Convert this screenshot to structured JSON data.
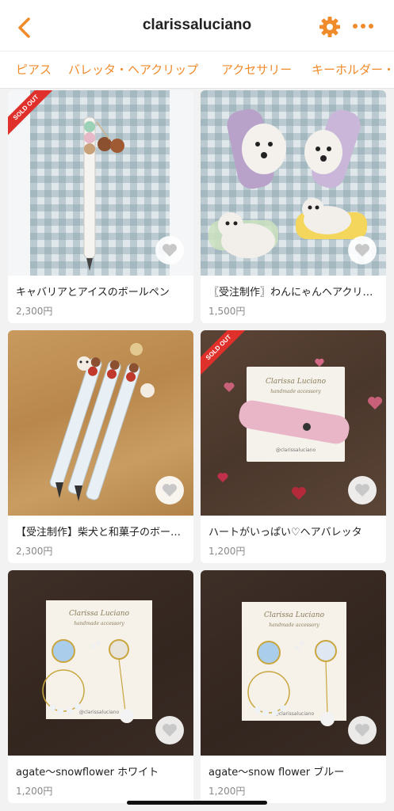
{
  "header": {
    "title": "clarissaluciano"
  },
  "tabs": [
    "ピアス",
    "バレッタ・ヘアクリップ",
    "アクセサリー",
    "キーホルダー・"
  ],
  "colors": {
    "accent": "#f08b2b",
    "sold_out": "#e0302b"
  },
  "items": [
    {
      "name": "キャバリアとアイスのボールペン",
      "price": "2,300円",
      "sold_out_badge": "SOLD OUT"
    },
    {
      "name": "〖受注制作〗わんにゃんヘアクリ…",
      "price": "1,500円"
    },
    {
      "name": "【受注制作】柴犬と和菓子のボー…",
      "price": "2,300円"
    },
    {
      "name": "ハートがいっぱい♡ヘアバレッタ",
      "price": "1,200円",
      "sold_out_badge": "SOLD OUT"
    },
    {
      "name": "agate～snowflower ホワイト",
      "price": "1,200円",
      "card_brand": "Clarissa Luciano",
      "card_sub": "handmade accessory",
      "card_handle": "@clarissaluciano"
    },
    {
      "name": "agate～snow flower ブルー",
      "price": "1,200円",
      "card_brand": "Clarissa Luciano",
      "card_sub": "handmade accessory",
      "card_handle": "@clarissaluciano"
    }
  ],
  "item4_card": {
    "brand": "Clarissa Luciano",
    "sub": "handmade accessory",
    "handle": "@clarissaluciano"
  }
}
